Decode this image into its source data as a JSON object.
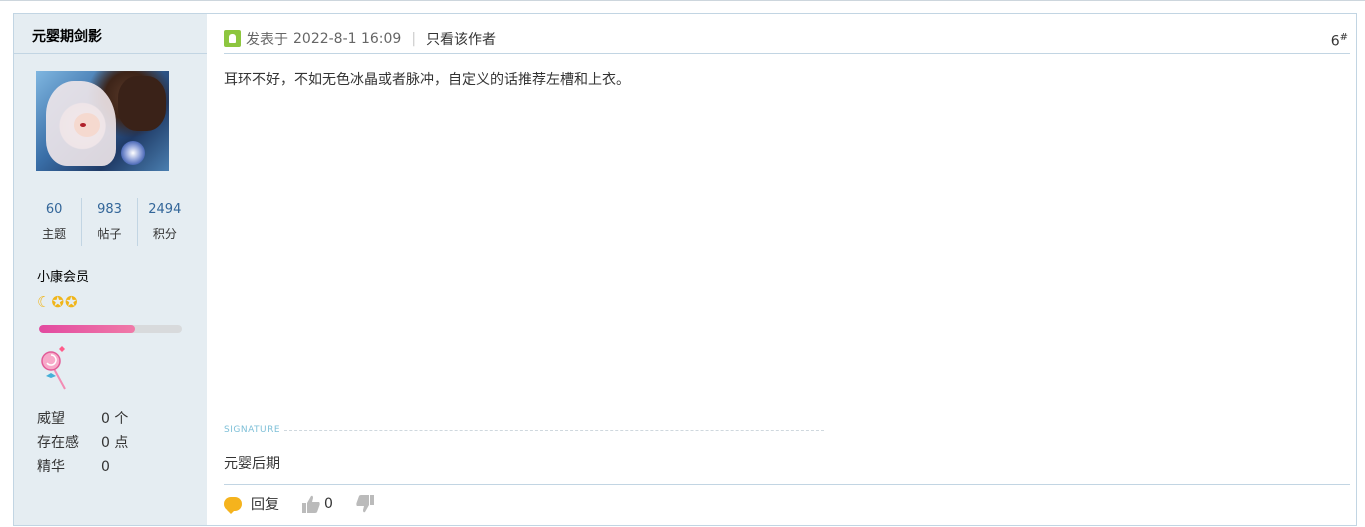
{
  "user": {
    "name": "元婴期剑影",
    "stats": [
      {
        "value": "60",
        "label": "主题"
      },
      {
        "value": "983",
        "label": "帖子"
      },
      {
        "value": "2494",
        "label": "积分"
      }
    ],
    "rank": "小康会员",
    "stars_icons": [
      "moon-icon",
      "star-icon",
      "star-icon"
    ],
    "exp_progress": 0.67,
    "info": [
      {
        "key": "威望",
        "value": "0 个"
      },
      {
        "key": "存在感",
        "value": "0 点"
      },
      {
        "key": "精华",
        "value": "0"
      }
    ]
  },
  "post": {
    "posted_prefix": "发表于",
    "posted_time": "2022-8-1 16:09",
    "separator": "|",
    "author_only": "只看该作者",
    "floor": "6",
    "floor_suffix": "#",
    "content": "耳环不好，不如无色冰晶或者脉冲，自定义的话推荐左槽和上衣。",
    "signature_label": "SIGNATURE",
    "signature": "元婴后期",
    "reply_label": "回复",
    "like_count": "0"
  },
  "colors": {
    "border": "#c2d5e3",
    "sidebar_bg": "#e5edf2",
    "accent_link": "#336699",
    "exp_bar": "#e24aa0"
  }
}
